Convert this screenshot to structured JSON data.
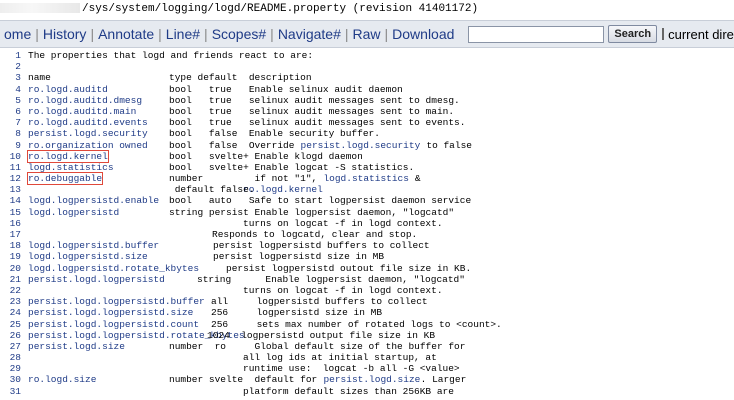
{
  "path": {
    "text": "/sys/system/logging/logd/README.property (revision 41401172)"
  },
  "nav": {
    "items": [
      "ome",
      "History",
      "Annotate",
      "Line#",
      "Scopes#",
      "Navigate#",
      "Raw",
      "Download"
    ],
    "search_placeholder": "",
    "search_button": "Search",
    "checkbox_label": "current director"
  },
  "colors": {
    "link": "#1f3b87",
    "highlight_box": "#e0483a",
    "nav_background": "#e6eaf0"
  },
  "code_lines": [
    {
      "n": "1",
      "segs": [
        {
          "text": "The properties that logd and friends react to are:"
        }
      ]
    },
    {
      "n": "2",
      "segs": []
    },
    {
      "n": "3",
      "segs": [
        {
          "text": "name"
        },
        {
          "text": "type default  description"
        }
      ]
    },
    {
      "n": "4",
      "segs": [
        {
          "text": "ro.logd.auditd",
          "link": true
        },
        {
          "text": "bool   true   Enable selinux audit daemon"
        }
      ]
    },
    {
      "n": "5",
      "segs": [
        {
          "text": "ro.logd.auditd.dmesg",
          "link": true
        },
        {
          "text": "bool   true   selinux audit messages sent to dmesg."
        }
      ]
    },
    {
      "n": "6",
      "segs": [
        {
          "text": "ro.logd.auditd.main",
          "link": true
        },
        {
          "text": "bool   true   selinux audit messages sent to main."
        }
      ]
    },
    {
      "n": "7",
      "segs": [
        {
          "text": "ro.logd.auditd.events",
          "link": true
        },
        {
          "text": "bool   true   selinux audit messages sent to events."
        }
      ]
    },
    {
      "n": "8",
      "segs": [
        {
          "text": "persist.logd.security",
          "link": true
        },
        {
          "text": "bool   false  Enable security buffer."
        }
      ]
    },
    {
      "n": "9",
      "segs": [
        {
          "text": "ro.organization owned",
          "link": true
        },
        {
          "text": "bool   false  Override "
        },
        {
          "text": "persist.logd.security",
          "link": true
        },
        {
          "text": " to false"
        }
      ]
    },
    {
      "n": "10",
      "segs": [
        {
          "text": "ro.logd.kernel",
          "link": true,
          "hl": true
        },
        {
          "text": "bool   svelte+ Enable klogd daemon"
        }
      ]
    },
    {
      "n": "11",
      "segs": [
        {
          "text": "logd.statistics",
          "link": true
        },
        {
          "text": "bool   svelte+ Enable logcat -S statistics."
        }
      ]
    },
    {
      "n": "12",
      "segs": [
        {
          "text": "ro.debuggable",
          "link": true,
          "hl": true
        },
        {
          "text": "number         if not \"1\", "
        },
        {
          "text": "logd.statistics",
          "link": true
        },
        {
          "text": " &"
        }
      ]
    },
    {
      "n": "13",
      "segs": [
        {
          "text": "ro.logd.kernel",
          "link": true,
          "col": "cont"
        },
        {
          "text": " default false."
        }
      ]
    },
    {
      "n": "14",
      "segs": [
        {
          "text": "logd.logpersistd.enable",
          "link": true
        },
        {
          "text": "bool   auto   Safe to start logpersist daemon service"
        }
      ]
    },
    {
      "n": "15",
      "segs": [
        {
          "text": "logd.logpersistd",
          "link": true
        },
        {
          "text": "string persist Enable logpersist daemon, \"logcatd\""
        }
      ]
    },
    {
      "n": "16",
      "segs": [
        {
          "text": "turns on logcat -f in logd context.",
          "col": "cont"
        }
      ]
    },
    {
      "n": "17",
      "segs": [
        {
          "text": "Responds to logcatd, clear and stop.",
          "col": "mid"
        }
      ]
    },
    {
      "n": "18",
      "segs": [
        {
          "text": "logd.logpersistd.buffer",
          "link": true
        },
        {
          "text": "persist logpersistd buffers to collect",
          "col": "p2"
        }
      ]
    },
    {
      "n": "19",
      "segs": [
        {
          "text": "logd.logpersistd.size",
          "link": true
        },
        {
          "text": "persist logpersistd size in MB",
          "col": "p2"
        }
      ]
    },
    {
      "n": "20",
      "segs": [
        {
          "text": "logd.logpersistd.rotate_kbytes",
          "link": true
        },
        {
          "text": "persist logpersistd outout file size in KB.",
          "col": "p3"
        }
      ]
    },
    {
      "n": "21",
      "segs": [
        {
          "text": "persist.logd.logpersistd",
          "link": true
        },
        {
          "text": "string      Enable logpersist daemon, \"logcatd\"",
          "col": "p4"
        }
      ]
    },
    {
      "n": "22",
      "segs": [
        {
          "text": "turns on logcat -f in logd context.",
          "col": "cont"
        }
      ]
    },
    {
      "n": "23",
      "segs": [
        {
          "text": "persist.logd.logpersistd.buffer",
          "link": true
        },
        {
          "text": "all     logpersistd buffers to collect",
          "col": "p5"
        }
      ]
    },
    {
      "n": "24",
      "segs": [
        {
          "text": "persist.logd.logpersistd.size",
          "link": true
        },
        {
          "text": "256     logpersistd size in MB",
          "col": "p5"
        }
      ]
    },
    {
      "n": "25",
      "segs": [
        {
          "text": "persist.logd.logpersistd.count",
          "link": true
        },
        {
          "text": "256     sets max number of rotated logs to <count>.",
          "col": "p5"
        }
      ]
    },
    {
      "n": "26",
      "segs": [
        {
          "text": "persist.logd.logpersistd.rotate_kbytes",
          "link": true
        },
        {
          "text": "1024  logpersistd output file size in KB",
          "col": "p6"
        }
      ]
    },
    {
      "n": "27",
      "segs": [
        {
          "text": "persist.logd.size",
          "link": true
        },
        {
          "text": "number  ro     Global default size of the buffer for"
        }
      ]
    },
    {
      "n": "28",
      "segs": [
        {
          "text": "all log ids at initial startup, at",
          "col": "cont"
        }
      ]
    },
    {
      "n": "29",
      "segs": [
        {
          "text": "runtime use:  logcat -b all -G <value>",
          "col": "cont"
        }
      ]
    },
    {
      "n": "30",
      "segs": [
        {
          "text": "ro.logd.size",
          "link": true
        },
        {
          "text": "number svelte  default for "
        },
        {
          "text": "persist.logd.size",
          "link": true
        },
        {
          "text": ". Larger"
        }
      ]
    },
    {
      "n": "31",
      "segs": [
        {
          "text": "platform default sizes than 256KB are",
          "col": "cont"
        }
      ]
    }
  ]
}
